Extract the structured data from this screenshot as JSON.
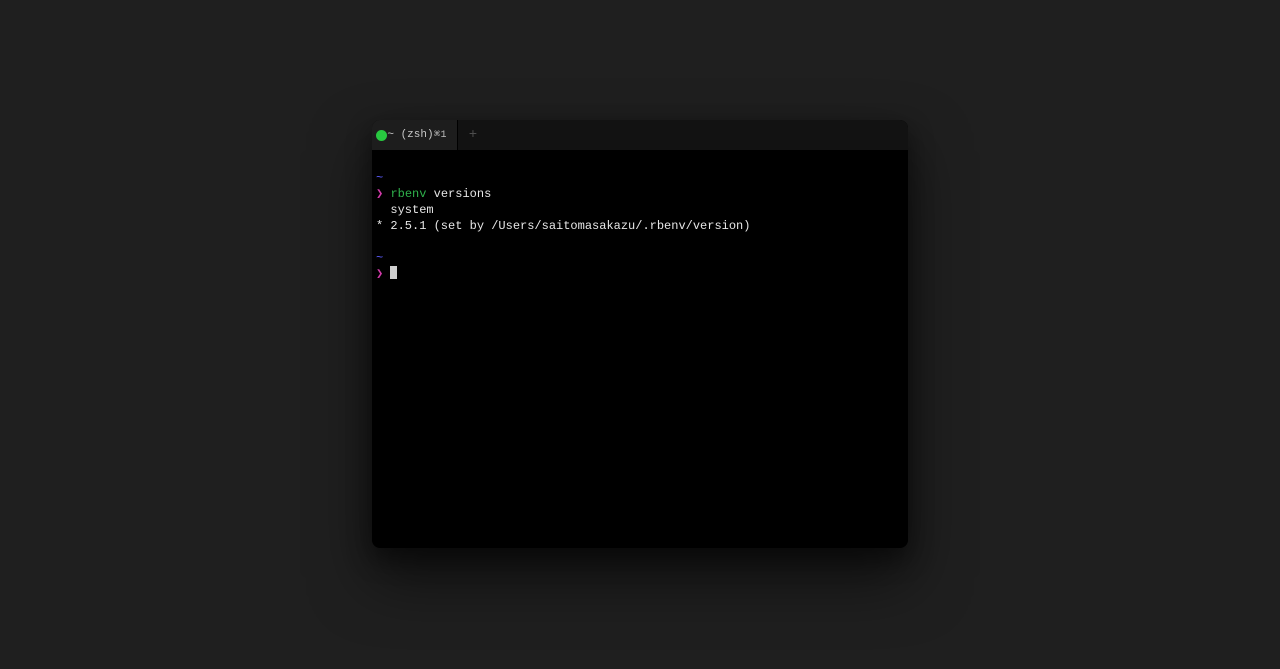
{
  "window": {
    "tab": {
      "title": "~ (zsh)",
      "shortcut": "⌘1"
    },
    "newtab_icon": "+"
  },
  "terminal": {
    "cwd_marker": "~",
    "prompt_char": "❯",
    "lines": {
      "cmd1_exe": "rbenv",
      "cmd1_args": " versions",
      "out1": "  system",
      "out2": "* 2.5.1 (set by /Users/saitomasakazu/.rbenv/version)"
    }
  }
}
